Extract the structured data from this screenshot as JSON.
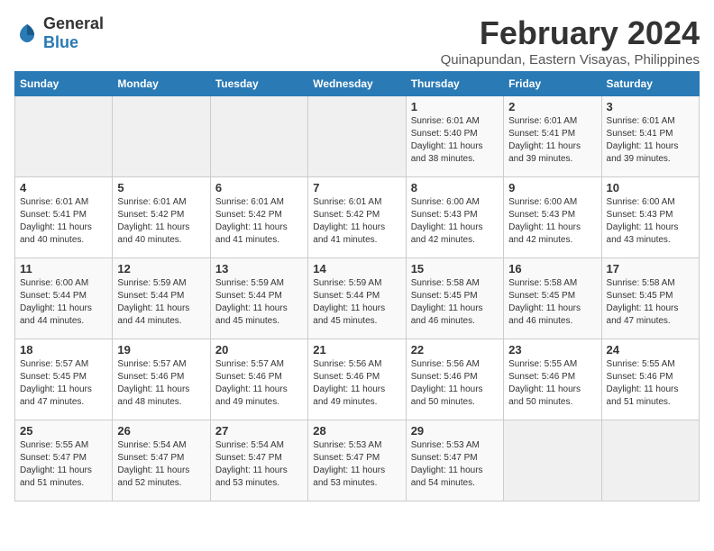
{
  "header": {
    "logo_general": "General",
    "logo_blue": "Blue",
    "title": "February 2024",
    "subtitle": "Quinapundan, Eastern Visayas, Philippines"
  },
  "calendar": {
    "days_of_week": [
      "Sunday",
      "Monday",
      "Tuesday",
      "Wednesday",
      "Thursday",
      "Friday",
      "Saturday"
    ],
    "weeks": [
      [
        {
          "day": "",
          "info": ""
        },
        {
          "day": "",
          "info": ""
        },
        {
          "day": "",
          "info": ""
        },
        {
          "day": "",
          "info": ""
        },
        {
          "day": "1",
          "info": "Sunrise: 6:01 AM\nSunset: 5:40 PM\nDaylight: 11 hours and 38 minutes."
        },
        {
          "day": "2",
          "info": "Sunrise: 6:01 AM\nSunset: 5:41 PM\nDaylight: 11 hours and 39 minutes."
        },
        {
          "day": "3",
          "info": "Sunrise: 6:01 AM\nSunset: 5:41 PM\nDaylight: 11 hours and 39 minutes."
        }
      ],
      [
        {
          "day": "4",
          "info": "Sunrise: 6:01 AM\nSunset: 5:41 PM\nDaylight: 11 hours and 40 minutes."
        },
        {
          "day": "5",
          "info": "Sunrise: 6:01 AM\nSunset: 5:42 PM\nDaylight: 11 hours and 40 minutes."
        },
        {
          "day": "6",
          "info": "Sunrise: 6:01 AM\nSunset: 5:42 PM\nDaylight: 11 hours and 41 minutes."
        },
        {
          "day": "7",
          "info": "Sunrise: 6:01 AM\nSunset: 5:42 PM\nDaylight: 11 hours and 41 minutes."
        },
        {
          "day": "8",
          "info": "Sunrise: 6:00 AM\nSunset: 5:43 PM\nDaylight: 11 hours and 42 minutes."
        },
        {
          "day": "9",
          "info": "Sunrise: 6:00 AM\nSunset: 5:43 PM\nDaylight: 11 hours and 42 minutes."
        },
        {
          "day": "10",
          "info": "Sunrise: 6:00 AM\nSunset: 5:43 PM\nDaylight: 11 hours and 43 minutes."
        }
      ],
      [
        {
          "day": "11",
          "info": "Sunrise: 6:00 AM\nSunset: 5:44 PM\nDaylight: 11 hours and 44 minutes."
        },
        {
          "day": "12",
          "info": "Sunrise: 5:59 AM\nSunset: 5:44 PM\nDaylight: 11 hours and 44 minutes."
        },
        {
          "day": "13",
          "info": "Sunrise: 5:59 AM\nSunset: 5:44 PM\nDaylight: 11 hours and 45 minutes."
        },
        {
          "day": "14",
          "info": "Sunrise: 5:59 AM\nSunset: 5:44 PM\nDaylight: 11 hours and 45 minutes."
        },
        {
          "day": "15",
          "info": "Sunrise: 5:58 AM\nSunset: 5:45 PM\nDaylight: 11 hours and 46 minutes."
        },
        {
          "day": "16",
          "info": "Sunrise: 5:58 AM\nSunset: 5:45 PM\nDaylight: 11 hours and 46 minutes."
        },
        {
          "day": "17",
          "info": "Sunrise: 5:58 AM\nSunset: 5:45 PM\nDaylight: 11 hours and 47 minutes."
        }
      ],
      [
        {
          "day": "18",
          "info": "Sunrise: 5:57 AM\nSunset: 5:45 PM\nDaylight: 11 hours and 47 minutes."
        },
        {
          "day": "19",
          "info": "Sunrise: 5:57 AM\nSunset: 5:46 PM\nDaylight: 11 hours and 48 minutes."
        },
        {
          "day": "20",
          "info": "Sunrise: 5:57 AM\nSunset: 5:46 PM\nDaylight: 11 hours and 49 minutes."
        },
        {
          "day": "21",
          "info": "Sunrise: 5:56 AM\nSunset: 5:46 PM\nDaylight: 11 hours and 49 minutes."
        },
        {
          "day": "22",
          "info": "Sunrise: 5:56 AM\nSunset: 5:46 PM\nDaylight: 11 hours and 50 minutes."
        },
        {
          "day": "23",
          "info": "Sunrise: 5:55 AM\nSunset: 5:46 PM\nDaylight: 11 hours and 50 minutes."
        },
        {
          "day": "24",
          "info": "Sunrise: 5:55 AM\nSunset: 5:46 PM\nDaylight: 11 hours and 51 minutes."
        }
      ],
      [
        {
          "day": "25",
          "info": "Sunrise: 5:55 AM\nSunset: 5:47 PM\nDaylight: 11 hours and 51 minutes."
        },
        {
          "day": "26",
          "info": "Sunrise: 5:54 AM\nSunset: 5:47 PM\nDaylight: 11 hours and 52 minutes."
        },
        {
          "day": "27",
          "info": "Sunrise: 5:54 AM\nSunset: 5:47 PM\nDaylight: 11 hours and 53 minutes."
        },
        {
          "day": "28",
          "info": "Sunrise: 5:53 AM\nSunset: 5:47 PM\nDaylight: 11 hours and 53 minutes."
        },
        {
          "day": "29",
          "info": "Sunrise: 5:53 AM\nSunset: 5:47 PM\nDaylight: 11 hours and 54 minutes."
        },
        {
          "day": "",
          "info": ""
        },
        {
          "day": "",
          "info": ""
        }
      ]
    ]
  }
}
